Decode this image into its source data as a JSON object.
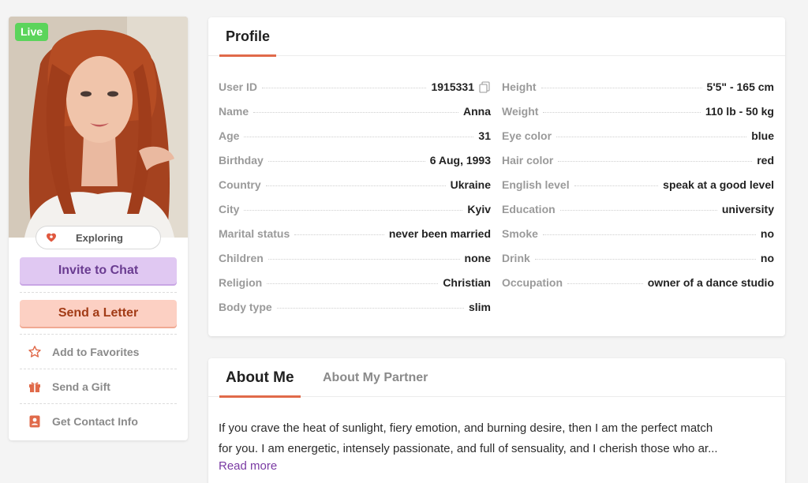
{
  "sidebar": {
    "live_badge": "Live",
    "status_label": "Exploring",
    "invite_label": "Invite to Chat",
    "letter_label": "Send a Letter",
    "actions": [
      {
        "icon": "star-icon",
        "label": "Add to Favorites"
      },
      {
        "icon": "gift-icon",
        "label": "Send a Gift"
      },
      {
        "icon": "contact-card-icon",
        "label": "Get Contact Info"
      }
    ]
  },
  "profile": {
    "title": "Profile",
    "left": [
      {
        "key": "User ID",
        "value": "1915331"
      },
      {
        "key": "Name",
        "value": "Anna"
      },
      {
        "key": "Age",
        "value": "31"
      },
      {
        "key": "Birthday",
        "value": "6 Aug, 1993"
      },
      {
        "key": "Country",
        "value": "Ukraine"
      },
      {
        "key": "City",
        "value": "Kyiv"
      },
      {
        "key": "Marital status",
        "value": "never been married"
      },
      {
        "key": "Children",
        "value": "none"
      },
      {
        "key": "Religion",
        "value": "Christian"
      },
      {
        "key": "Body type",
        "value": "slim"
      }
    ],
    "right": [
      {
        "key": "Height",
        "value": "5'5\" - 165 cm"
      },
      {
        "key": "Weight",
        "value": "110 lb - 50 kg"
      },
      {
        "key": "Eye color",
        "value": "blue"
      },
      {
        "key": "Hair color",
        "value": "red"
      },
      {
        "key": "English level",
        "value": "speak at a good level"
      },
      {
        "key": "Education",
        "value": "university"
      },
      {
        "key": "Smoke",
        "value": "no"
      },
      {
        "key": "Drink",
        "value": "no"
      },
      {
        "key": "Occupation",
        "value": "owner of a dance studio"
      }
    ]
  },
  "about": {
    "tab_active": "About Me",
    "tab_inactive": "About My Partner",
    "line1": "If you crave the heat of sunlight, fiery emotion, and burning desire, then I am the perfect match",
    "line2": "for you. I am energetic, intensely passionate, and full of sensuality, and I cherish those who ar...",
    "read_more": "Read more"
  },
  "colors": {
    "accent": "#e06a4a",
    "live": "#5bd45b",
    "chat_button": "#e0c8f2",
    "letter_button": "#fcd0c3",
    "link": "#7a3aa3"
  }
}
